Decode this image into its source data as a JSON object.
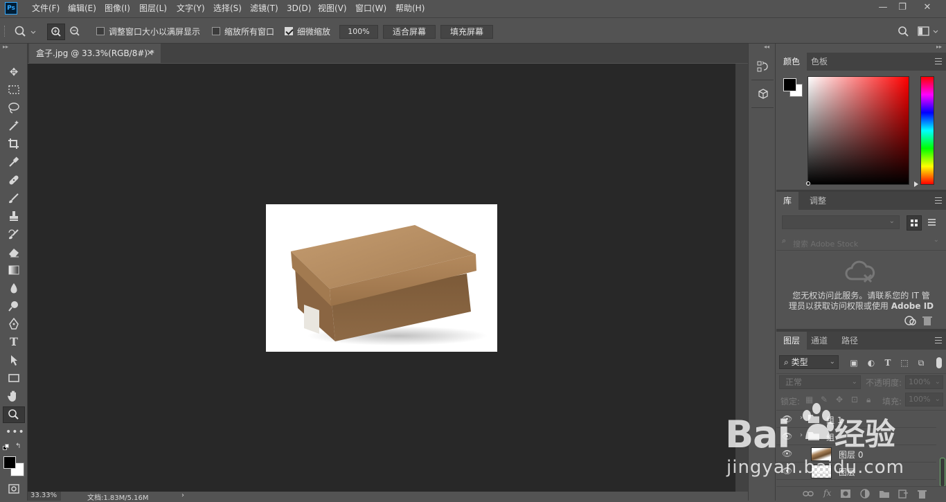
{
  "app": {
    "logo": "Ps"
  },
  "menus": [
    "文件(F)",
    "编辑(E)",
    "图像(I)",
    "图层(L)",
    "文字(Y)",
    "选择(S)",
    "滤镜(T)",
    "3D(D)",
    "视图(V)",
    "窗口(W)",
    "帮助(H)"
  ],
  "window_controls": {
    "minimize": "—",
    "restore": "❐",
    "close": "✕"
  },
  "options": {
    "resize_windows_label": "调整窗口大小以满屏显示",
    "resize_windows_checked": false,
    "zoom_all_label": "缩放所有窗口",
    "zoom_all_checked": false,
    "scrubby_zoom_label": "细微缩放",
    "scrubby_zoom_checked": true,
    "zoom_value": "100%",
    "fit_screen_label": "适合屏幕",
    "fill_screen_label": "填充屏幕"
  },
  "document": {
    "tab_title": "盒子.jpg @ 33.3%(RGB/8#) *",
    "tab_close": "×",
    "zoom_status": "33.33%",
    "doc_size": "文档:1.83M/5.16M",
    "status_arrow": "›"
  },
  "color_panel": {
    "tabs": [
      "颜色",
      "色板"
    ]
  },
  "library_panel": {
    "tabs": [
      "库",
      "调整"
    ],
    "search_placeholder": "搜索 Adobe Stock",
    "message_line1": "您无权访问此服务。请联系您的 IT 管",
    "message_line2": "理员以获取访问权限或使用 ",
    "message_bold": "Adobe ID"
  },
  "layers_panel": {
    "tabs": [
      "图层",
      "通道",
      "路径"
    ],
    "filter_kind": "类型",
    "blend_mode": "正常",
    "opacity_label": "不透明度:",
    "opacity_value": "100%",
    "lock_label": "锁定:",
    "fill_label": "填充:",
    "fill_value": "100%",
    "layers": [
      {
        "name": "组 1",
        "type": "group"
      },
      {
        "name": "组",
        "type": "group"
      },
      {
        "name": "图层 0",
        "type": "layer"
      },
      {
        "name": "图层",
        "type": "layer"
      }
    ],
    "footer_icons": [
      "link-icon",
      "fx-icon",
      "mask-icon",
      "adjustment-icon",
      "folder-icon",
      "new-layer-icon",
      "trash-icon"
    ],
    "fx_label": "fx"
  },
  "watermark": {
    "main": "Bai",
    "du_paw": "du",
    "right": "经验",
    "url": "jingyan.baidu.com"
  },
  "colors": {
    "foreground": "#000000",
    "background": "#ffffff",
    "accent": "#31a8ff"
  }
}
